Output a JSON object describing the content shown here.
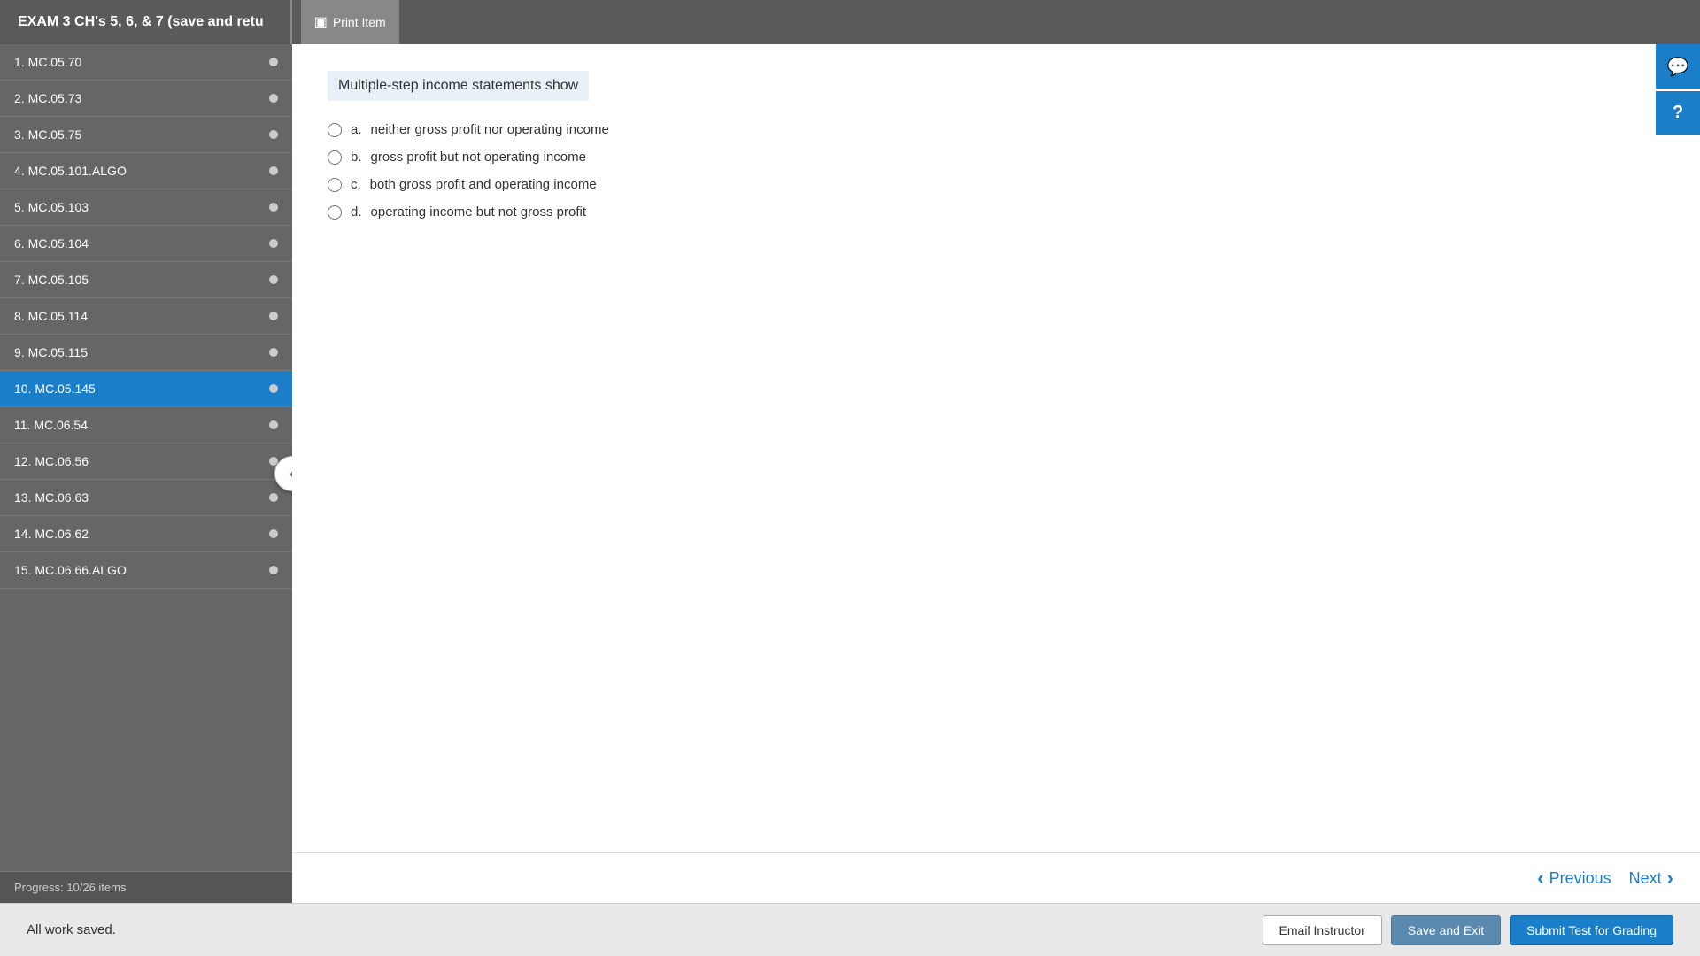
{
  "header": {
    "title": "EXAM 3 CH's 5, 6, & 7 (save and retu",
    "print_label": "Print Item"
  },
  "sidebar": {
    "items": [
      {
        "number": "1.",
        "code": "MC.05.70",
        "active": false
      },
      {
        "number": "2.",
        "code": "MC.05.73",
        "active": false
      },
      {
        "number": "3.",
        "code": "MC.05.75",
        "active": false
      },
      {
        "number": "4.",
        "code": "MC.05.101.ALGO",
        "active": false
      },
      {
        "number": "5.",
        "code": "MC.05.103",
        "active": false
      },
      {
        "number": "6.",
        "code": "MC.05.104",
        "active": false
      },
      {
        "number": "7.",
        "code": "MC.05.105",
        "active": false
      },
      {
        "number": "8.",
        "code": "MC.05.114",
        "active": false
      },
      {
        "number": "9.",
        "code": "MC.05.115",
        "active": false
      },
      {
        "number": "10.",
        "code": "MC.05.145",
        "active": true
      },
      {
        "number": "11.",
        "code": "MC.06.54",
        "active": false
      },
      {
        "number": "12.",
        "code": "MC.06.56",
        "active": false
      },
      {
        "number": "13.",
        "code": "MC.06.63",
        "active": false
      },
      {
        "number": "14.",
        "code": "MC.06.62",
        "active": false
      },
      {
        "number": "15.",
        "code": "MC.06.66.ALGO",
        "active": false
      }
    ],
    "progress_label": "Progress:",
    "progress_value": "10/26 items"
  },
  "question": {
    "text": "Multiple-step income statements show",
    "options": [
      {
        "letter": "a.",
        "text": "neither gross profit nor operating income"
      },
      {
        "letter": "b.",
        "text": "gross profit but not operating income"
      },
      {
        "letter": "c.",
        "text": "both gross profit and operating income"
      },
      {
        "letter": "d.",
        "text": "operating income but not gross profit"
      }
    ]
  },
  "navigation": {
    "previous_label": "Previous",
    "next_label": "Next"
  },
  "footer": {
    "status": "All work saved.",
    "email_label": "Email Instructor",
    "save_label": "Save and Exit",
    "submit_label": "Submit Test for Grading"
  },
  "widgets": {
    "chat_icon": "💬",
    "help_icon": "?"
  }
}
